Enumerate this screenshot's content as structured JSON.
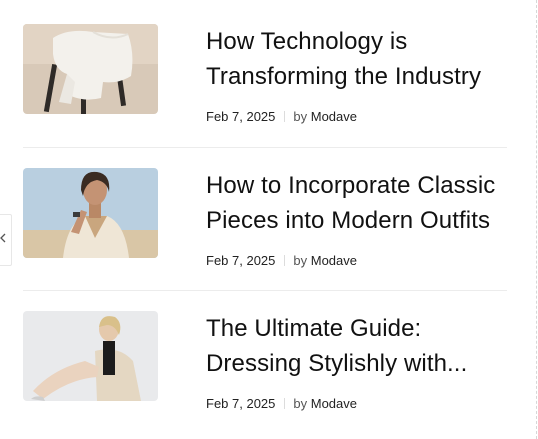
{
  "posts": [
    {
      "title_line1": "How Technology is",
      "title_line2": "Transforming the Industry",
      "date": "Feb 7, 2025",
      "by": "by",
      "author": "Modave"
    },
    {
      "title_line1": "How to Incorporate Classic",
      "title_line2": "Pieces into Modern Outfits",
      "date": "Feb 7, 2025",
      "by": "by",
      "author": "Modave"
    },
    {
      "title_line1": "The Ultimate Guide:",
      "title_line2": "Dressing Stylishly with...",
      "date": "Feb 7, 2025",
      "by": "by",
      "author": "Modave"
    }
  ],
  "icons": {
    "left_nav": "chevron-left-icon"
  }
}
